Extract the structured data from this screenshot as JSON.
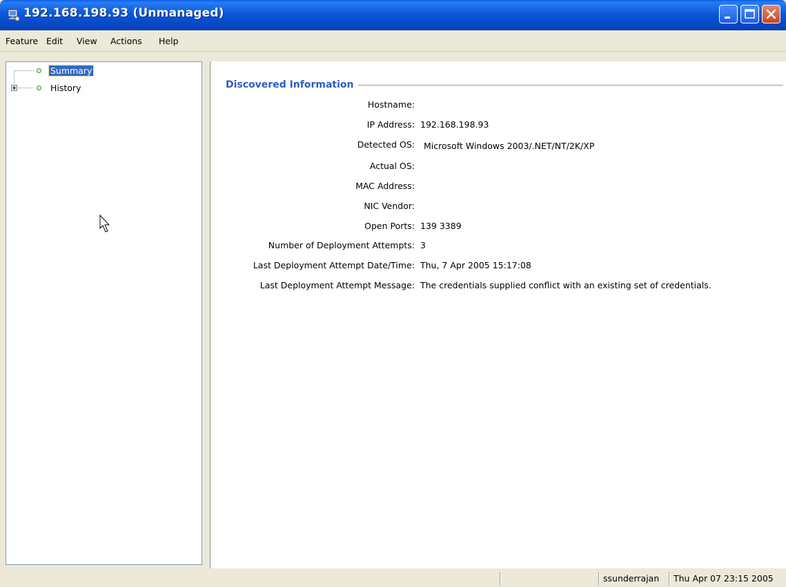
{
  "window": {
    "title": "192.168.198.93 (Unmanaged)"
  },
  "menu": [
    {
      "label": "Feature"
    },
    {
      "label": "Edit"
    },
    {
      "label": "View"
    },
    {
      "label": "Actions"
    },
    {
      "label": "Help"
    }
  ],
  "tree": {
    "items": [
      {
        "label": "Summary",
        "selected": true,
        "expandable": false
      },
      {
        "label": "History",
        "selected": false,
        "expandable": true
      }
    ]
  },
  "section": {
    "title": "Discovered Information"
  },
  "info": [
    {
      "label": "Hostname:",
      "value": ""
    },
    {
      "label": "IP Address:",
      "value": "192.168.198.93"
    },
    {
      "label": "Detected OS:",
      "value": "Microsoft Windows 2003/.NET/NT/2K/XP"
    },
    {
      "label": "Actual OS:",
      "value": ""
    },
    {
      "label": "MAC Address:",
      "value": ""
    },
    {
      "label": "NIC Vendor:",
      "value": ""
    },
    {
      "label": "Open Ports:",
      "value": "139 3389"
    },
    {
      "label": "Number of Deployment Attempts:",
      "value": "3"
    },
    {
      "label": "Last Deployment Attempt Date/Time:",
      "value": "Thu, 7 Apr 2005 15:17:08"
    },
    {
      "label": "Last Deployment Attempt Message:",
      "value": "The credentials supplied conflict with an existing set of credentials."
    }
  ],
  "status": {
    "user": "ssunderrajan",
    "datetime": "Thu Apr 07 23:15 2005"
  },
  "colors": {
    "titlebar": "#0546c4",
    "section_title": "#2f5bc4",
    "selection": "#316ac5",
    "close_button": "#c8451f"
  },
  "icons": {
    "title": "network-computer-icon",
    "minimize": "minimize-icon",
    "maximize": "maximize-icon",
    "close": "close-icon",
    "tree_node": "status-dot-icon",
    "expander": "plus-expander-icon"
  }
}
